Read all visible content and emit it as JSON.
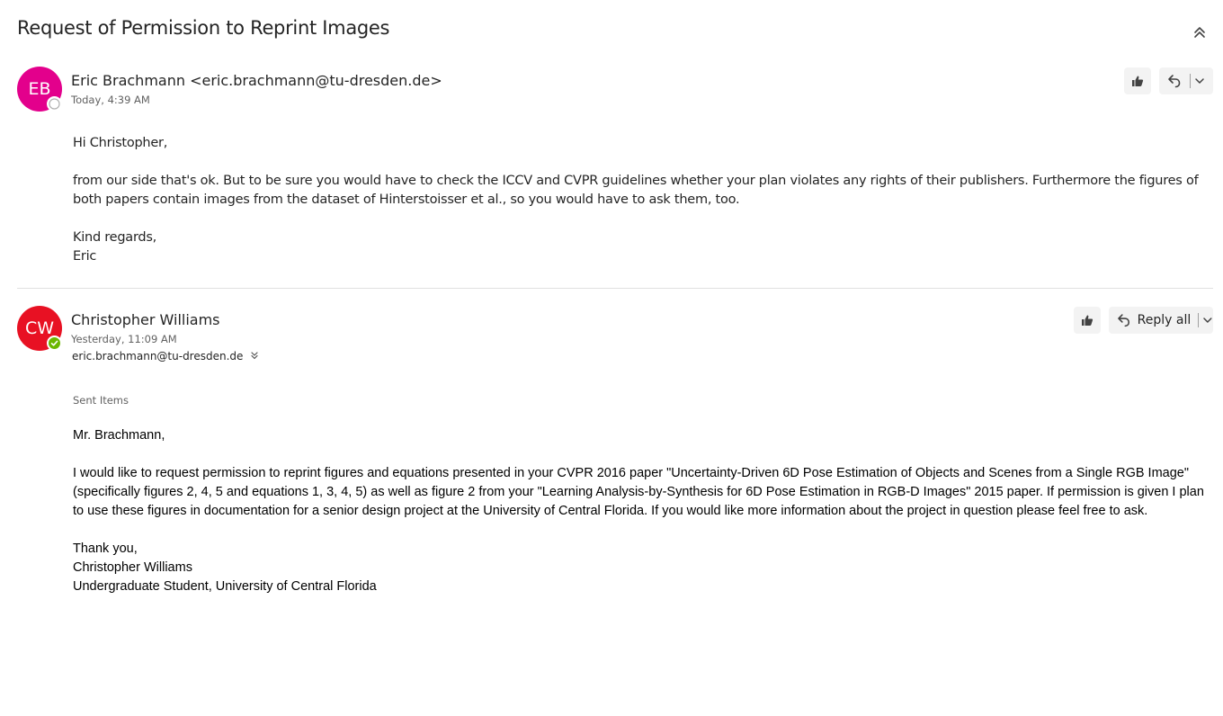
{
  "subject": "Request of Permission to Reprint Images",
  "messages": [
    {
      "initials": "EB",
      "avatar_color": "#e3008c",
      "sender": "Eric Brachmann <eric.brachmann@tu-dresden.de>",
      "time": "Today, 4:39 AM",
      "body": [
        "Hi Christopher,",
        "from our side that's ok. But to be sure you would have to check the ICCV and CVPR guidelines whether your plan violates any rights of their publishers. Furthermore the figures of both papers contain images from the dataset of Hinterstoisser et al., so you would have to ask them, too.",
        "Kind regards,",
        "Eric"
      ]
    },
    {
      "initials": "CW",
      "avatar_color": "#e81123",
      "sender": "Christopher Williams",
      "time": "Yesterday, 11:09 AM",
      "recipient": "eric.brachmann@tu-dresden.de",
      "folder": "Sent Items",
      "reply_all_label": "Reply all",
      "body": [
        "Mr. Brachmann,",
        "I would like to request permission to reprint figures and equations presented in your CVPR 2016 paper \"Uncertainty-Driven 6D Pose Estimation of Objects and Scenes from a Single RGB Image\" (specifically figures 2, 4, 5 and equations 1, 3, 4, 5) as well as figure 2 from your \"Learning Analysis-by-Synthesis for 6D Pose Estimation in RGB-D Images\" 2015 paper. If permission is given I plan to use these figures in documentation for a senior design project at the University of Central Florida. If you would like more information about the project in question please feel free to ask.",
        "Thank you,",
        "Christopher Williams",
        "Undergraduate Student, University of Central Florida"
      ]
    }
  ],
  "icons": {
    "collapse": "chevron-double-up-icon",
    "like": "thumbs-up-icon",
    "reply": "reply-icon",
    "more": "chevron-down-icon",
    "expand_recipients": "chevron-double-down-icon",
    "presence_offline": "presence-away-icon",
    "presence_online": "presence-available-icon"
  },
  "colors": {
    "presence_available": "#6bb700",
    "divider": "#e1e1e1",
    "button_bg": "#f3f3f3"
  }
}
